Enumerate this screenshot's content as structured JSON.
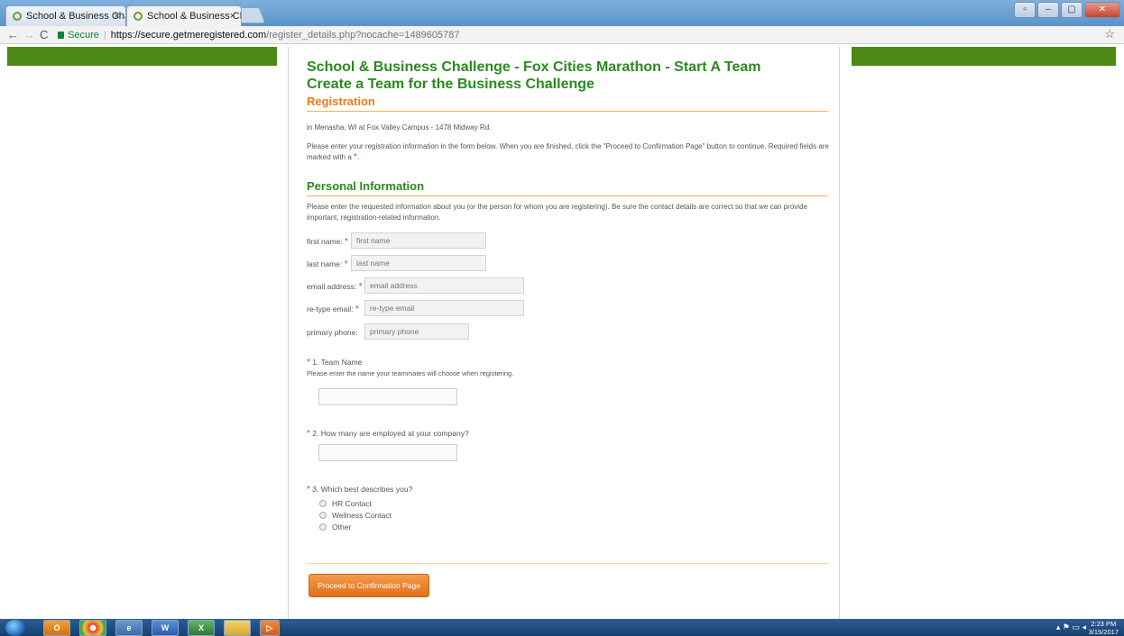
{
  "browser": {
    "tabs": [
      {
        "label": "School & Business Challe"
      },
      {
        "label": "School & Business Challe"
      }
    ],
    "url_secure": "Secure",
    "url_host": "https://secure.getmeregistered.com",
    "url_path": "/register_details.php?nocache=1489605787"
  },
  "page": {
    "title_line1": "School & Business Challenge - Fox Cities Marathon - Start A Team",
    "title_line2": "Create a Team for the Business Challenge",
    "section": "Registration",
    "location": "in Menasha, WI at Fox Valley Campus - 1478 Midway Rd.",
    "instructions": "Please enter your registration information in the form below. When you are finished, click the \"Proceed to Confirmation Page\" button to continue. Required fields are marked with a ",
    "personal_title": "Personal Information",
    "personal_desc": "Please enter the requested information about you (or the person for whom you are registering). Be sure the contact details are correct so that we can provide important, registration-related information."
  },
  "form": {
    "first_name": {
      "label": "first name:",
      "placeholder": "first name"
    },
    "last_name": {
      "label": "last name:",
      "placeholder": "last name"
    },
    "email": {
      "label": "email address:",
      "placeholder": "email address"
    },
    "retype_email": {
      "label": "re-type email:",
      "placeholder": "re-type email"
    },
    "phone": {
      "label": "primary phone:",
      "placeholder": "primary phone"
    },
    "q1_label": "1. Team Name",
    "q1_help": "Please enter the name your teammates will choose when registering.",
    "q2_label": "2. How many are employed at your company?",
    "q3_label": "3. Which best describes you?",
    "q3_options": [
      "HR Contact",
      "Wellness Contact",
      "Other"
    ],
    "proceed_label": "Proceed to Confirmation Page"
  },
  "taskbar": {
    "clock_time": "2:23 PM",
    "clock_date": "3/15/2017"
  },
  "colors": {
    "brand_green": "#4b8a14",
    "heading_green": "#2b8a1e",
    "accent_orange": "#ee7a1d",
    "required_red": "#e23b2a"
  }
}
